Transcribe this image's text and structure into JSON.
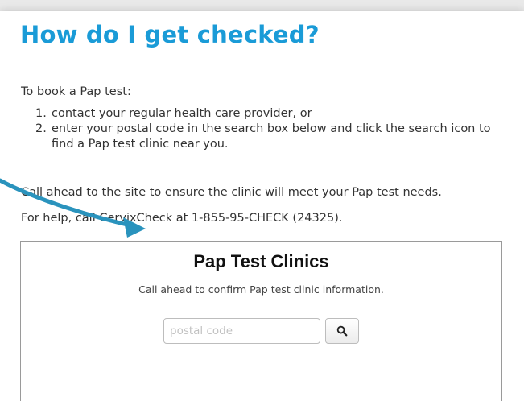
{
  "heading": "How do I get checked?",
  "intro": "To book a Pap test:",
  "steps": [
    {
      "number": "1.",
      "text": "contact your regular health care provider, or"
    },
    {
      "number": "2.",
      "text": "enter your postal code in the search box below and click the search icon to find a Pap test clinic near you."
    }
  ],
  "note": "Call ahead to the site to ensure the clinic will meet your Pap test needs.",
  "help": "For help, call CervixCheck at 1-855-95-CHECK (24325).",
  "clinic_finder": {
    "title": "Pap Test Clinics",
    "subtitle": "Call ahead to confirm Pap test clinic information.",
    "search_placeholder": "postal code",
    "search_value": "",
    "search_icon": "search-icon"
  },
  "colors": {
    "heading": "#1a9bd7",
    "arrow": "#2a93bd",
    "body_text": "#333333",
    "border": "#9a9a9a"
  }
}
